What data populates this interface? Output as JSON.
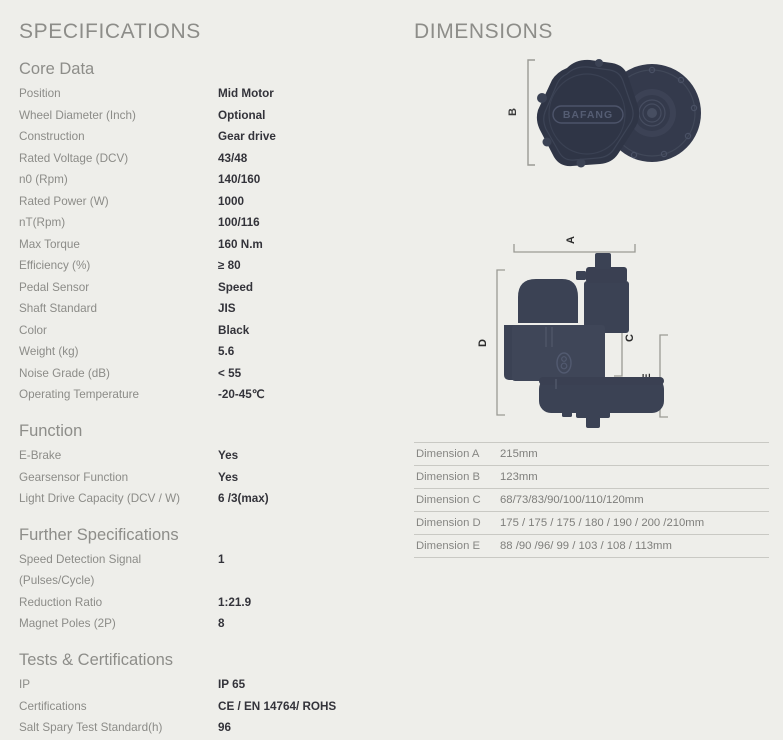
{
  "left_panel": {
    "title": "SPECIFICATIONS",
    "sections": [
      {
        "heading": "Core Data",
        "rows": [
          {
            "label": "Position",
            "value": "Mid Motor"
          },
          {
            "label": "Wheel Diameter (Inch)",
            "value": "Optional"
          },
          {
            "label": "Construction",
            "value": "Gear drive"
          },
          {
            "label": "Rated Voltage (DCV)",
            "value": "43/48"
          },
          {
            "label": "n0 (Rpm)",
            "value": "140/160"
          },
          {
            "label": "Rated Power (W)",
            "value": "1000"
          },
          {
            "label": "nT(Rpm)",
            "value": "100/116"
          },
          {
            "label": "Max Torque",
            "value": "160 N.m"
          },
          {
            "label": "Efficiency (%)",
            "value": "≥ 80"
          },
          {
            "label": "Pedal Sensor",
            "value": "Speed"
          },
          {
            "label": "Shaft Standard",
            "value": "JIS"
          },
          {
            "label": "Color",
            "value": "Black"
          },
          {
            "label": "Weight (kg)",
            "value": "5.6"
          },
          {
            "label": "Noise Grade (dB)",
            "value": "< 55"
          },
          {
            "label": "Operating Temperature",
            "value": "-20-45℃"
          }
        ]
      },
      {
        "heading": "Function",
        "rows": [
          {
            "label": "E-Brake",
            "value": "Yes"
          },
          {
            "label": "Gearsensor Function",
            "value": "Yes"
          },
          {
            "label": "Light Drive Capacity (DCV / W)",
            "value": "6 /3(max)"
          }
        ]
      },
      {
        "heading": "Further Specifications",
        "rows": [
          {
            "label": "Speed Detection Signal",
            "label2": "(Pulses/Cycle)",
            "value": "1"
          },
          {
            "label": "Reduction Ratio",
            "value": "1:21.9"
          },
          {
            "label": "Magnet Poles (2P)",
            "value": "8"
          }
        ]
      },
      {
        "heading": "Tests & Certifications",
        "rows": [
          {
            "label": "IP",
            "value": "IP 65"
          },
          {
            "label": "Certifications",
            "value": "CE / EN 14764/ ROHS"
          },
          {
            "label": "Salt Spary Test Standard(h)",
            "value": "96"
          }
        ]
      }
    ]
  },
  "right_panel": {
    "title": "DIMENSIONS",
    "drawing_top": {
      "brand_text": "BAFANG",
      "dimension_marks": [
        "B"
      ]
    },
    "drawing_bottom": {
      "dimension_marks": [
        "A",
        "C",
        "D",
        "E"
      ]
    },
    "dimension_table": {
      "rows": [
        {
          "key": "Dimension A",
          "value": "215mm"
        },
        {
          "key": "Dimension B",
          "value": "123mm"
        },
        {
          "key": "Dimension C",
          "value": "68/73/83/90/100/110/120mm"
        },
        {
          "key": "Dimension D",
          "value": "175 / 175 / 175 / 180 / 190 / 200 /210mm"
        },
        {
          "key": "Dimension E",
          "value": "88 /90 /96/ 99 / 103 / 108 / 113mm"
        }
      ]
    }
  },
  "colors": {
    "background": "#eeeeea",
    "heading_gray": "#8d8d89",
    "label_gray": "#8c8c88",
    "value_dark": "#33333a",
    "motor_dark": "#3a4154",
    "motor_darker": "#2f3546",
    "bracket_gray": "#9a9a95",
    "table_rule": "#c9c9c4"
  }
}
